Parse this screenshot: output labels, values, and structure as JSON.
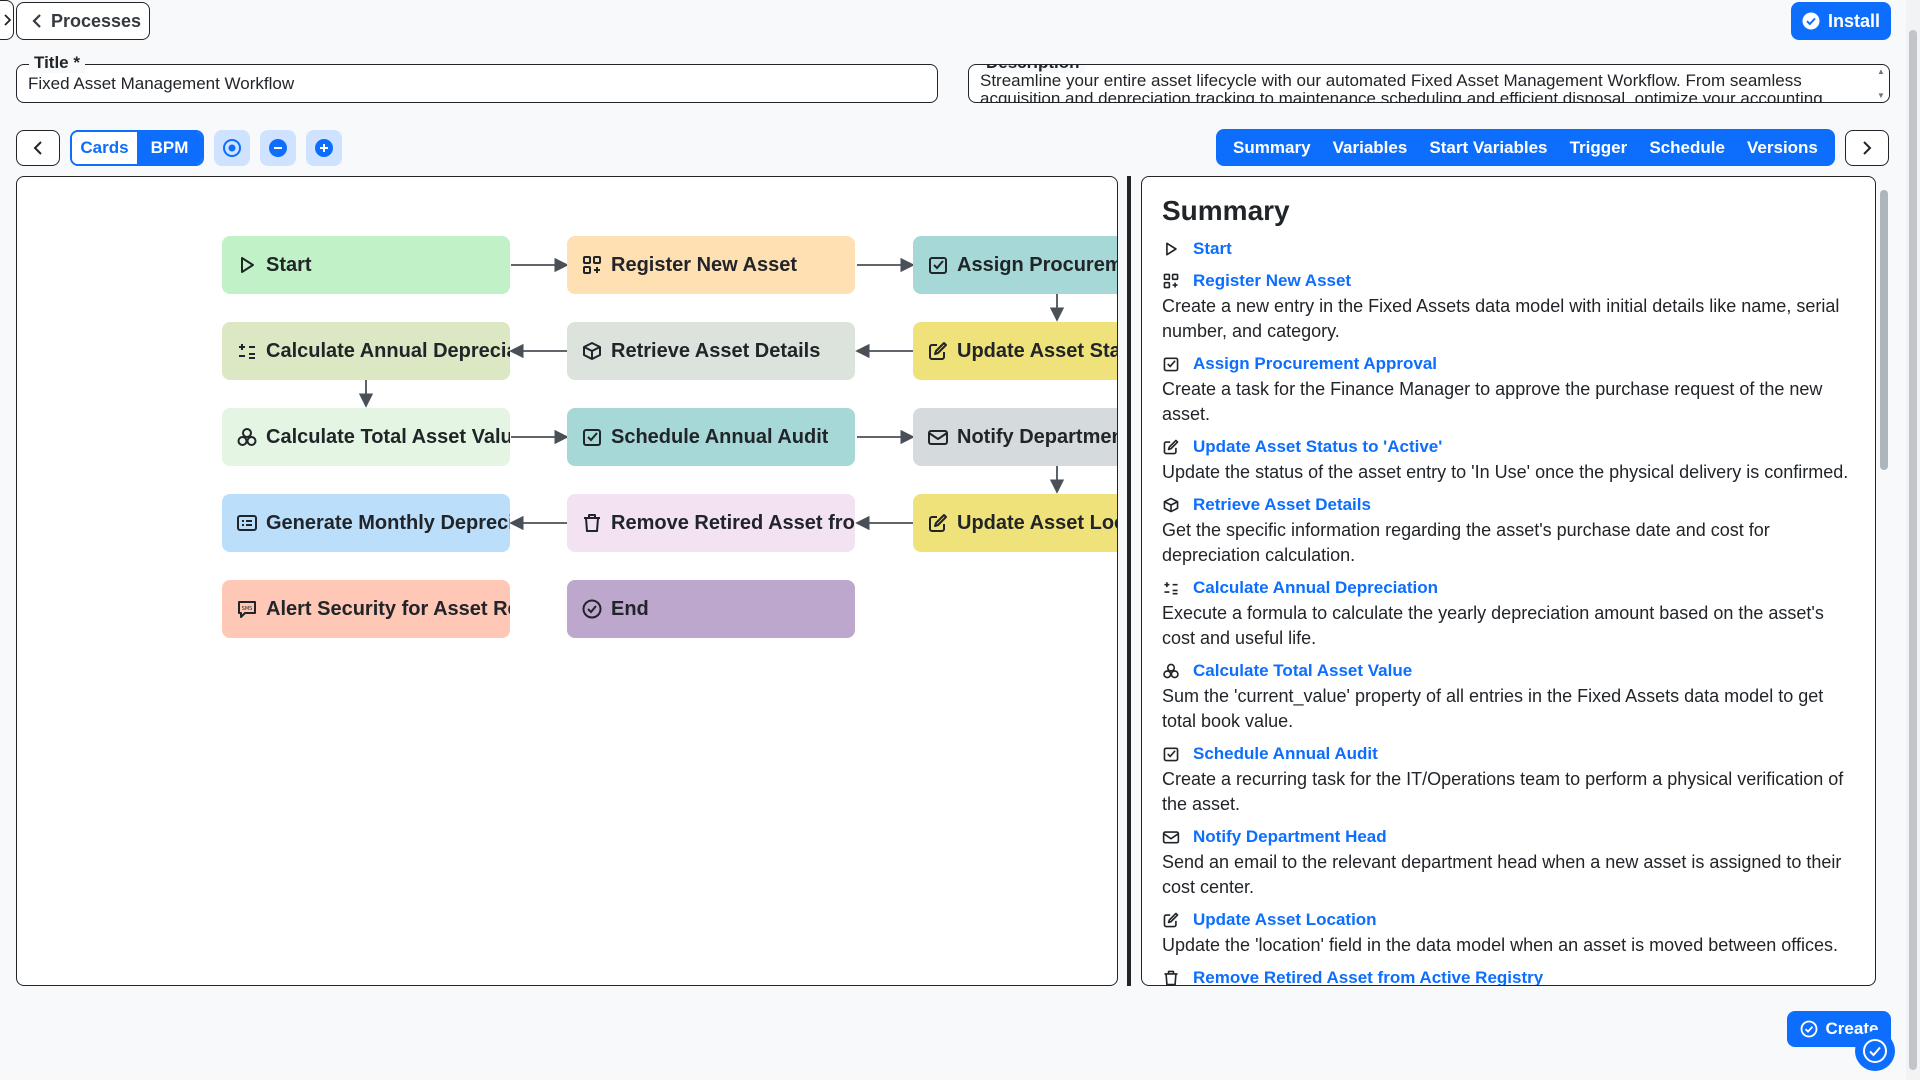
{
  "header": {
    "back_label": "Processes",
    "install_label": "Install"
  },
  "form": {
    "title_label": "Title *",
    "title_value": "Fixed Asset Management Workflow",
    "description_label": "Description",
    "description_value": "Streamline your entire asset lifecycle with our automated Fixed Asset Management Workflow. From seamless acquisition and depreciation tracking to maintenance scheduling and efficient disposal, optimize your accounting"
  },
  "toolbar": {
    "view_tabs": [
      "Cards",
      "BPM"
    ],
    "active_view": "BPM",
    "panel_tabs": [
      "Summary",
      "Variables",
      "Start Variables",
      "Trigger",
      "Schedule",
      "Versions"
    ]
  },
  "colors": {
    "primary": "#0d6efd",
    "start": "#c1f2c7",
    "register": "#ffe0b3",
    "assign": "#a5d8d6",
    "update_status": "#f0e27a",
    "retrieve": "#dce3dc",
    "calc_dep": "#dce8c4",
    "calc_total": "#e4f5e3",
    "schedule_audit": "#a5d8d6",
    "notify": "#d5dbdc",
    "update_location": "#f0e27a",
    "remove": "#f2e2f2",
    "generate": "#bbdefa",
    "alert": "#ffc7b5",
    "end": "#bea7cc"
  },
  "flow": {
    "nodes": [
      {
        "label": "Start",
        "icon": "play-icon"
      },
      {
        "label": "Register New Asset",
        "icon": "apps-add-icon"
      },
      {
        "label": "Assign Procurement Approval",
        "icon": "checkbox-icon"
      },
      {
        "label": "Calculate Annual Depreciation",
        "icon": "formula-icon"
      },
      {
        "label": "Retrieve Asset Details",
        "icon": "box-icon"
      },
      {
        "label": "Update Asset Status to 'Active'",
        "icon": "edit-icon"
      },
      {
        "label": "Calculate Total Asset Value",
        "icon": "aggregate-icon"
      },
      {
        "label": "Schedule Annual Audit",
        "icon": "checkbox-icon"
      },
      {
        "label": "Notify Department Head",
        "icon": "mail-icon"
      },
      {
        "label": "Generate Monthly Depreciation Report",
        "icon": "report-icon"
      },
      {
        "label": "Remove Retired Asset from Active Registry",
        "icon": "trash-icon"
      },
      {
        "label": "Update Asset Location",
        "icon": "edit-icon"
      },
      {
        "label": "Alert Security for Asset Removal",
        "icon": "sms-icon"
      },
      {
        "label": "End",
        "icon": "check-circle-icon"
      }
    ]
  },
  "summary": {
    "title": "Summary",
    "items": [
      {
        "label": "Start",
        "icon": "play-icon",
        "desc": ""
      },
      {
        "label": "Register New Asset",
        "icon": "apps-add-icon",
        "desc": "Create a new entry in the Fixed Assets data model with initial details like name, serial number, and category."
      },
      {
        "label": "Assign Procurement Approval",
        "icon": "checkbox-icon",
        "desc": "Create a task for the Finance Manager to approve the purchase request of the new asset."
      },
      {
        "label": "Update Asset Status to 'Active'",
        "icon": "edit-icon",
        "desc": "Update the status of the asset entry to 'In Use' once the physical delivery is confirmed."
      },
      {
        "label": "Retrieve Asset Details",
        "icon": "box-icon",
        "desc": "Get the specific information regarding the asset's purchase date and cost for depreciation calculation."
      },
      {
        "label": "Calculate Annual Depreciation",
        "icon": "formula-icon",
        "desc": "Execute a formula to calculate the yearly depreciation amount based on the asset's cost and useful life."
      },
      {
        "label": "Calculate Total Asset Value",
        "icon": "aggregate-icon",
        "desc": "Sum the 'current_value' property of all entries in the Fixed Assets data model to get total book value."
      },
      {
        "label": "Schedule Annual Audit",
        "icon": "checkbox-icon",
        "desc": "Create a recurring task for the IT/Operations team to perform a physical verification of the asset."
      },
      {
        "label": "Notify Department Head",
        "icon": "mail-icon",
        "desc": "Send an email to the relevant department head when a new asset is assigned to their cost center."
      },
      {
        "label": "Update Asset Location",
        "icon": "edit-icon",
        "desc": "Update the 'location' field in the data model when an asset is moved between offices."
      },
      {
        "label": "Remove Retired Asset from Active Registry",
        "icon": "trash-icon",
        "desc": ""
      }
    ]
  },
  "footer": {
    "create_label": "Create"
  }
}
